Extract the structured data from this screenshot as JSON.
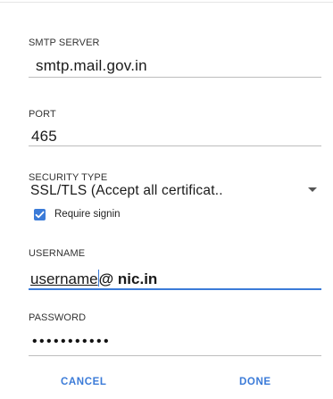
{
  "smtp_server": {
    "label": "SMTP SERVER",
    "value": "smtp.mail.gov.in"
  },
  "port": {
    "label": "PORT",
    "value": "465"
  },
  "security_type": {
    "label": "SECURITY TYPE",
    "value": "SSL/TLS (Accept all certificat..",
    "icon": "dropdown-arrow-icon"
  },
  "require_signin": {
    "label": "Require signin",
    "checked": true,
    "icon": "checkmark-icon"
  },
  "username": {
    "label": "USERNAME",
    "value_part1": "username",
    "value_part2": "@ nic.in"
  },
  "password": {
    "label": "PASSWORD",
    "value": "•••••••••••"
  },
  "buttons": {
    "cancel": "CANCEL",
    "done": "DONE"
  },
  "colors": {
    "accent": "#3b7bd8",
    "divider": "#bdbdbd",
    "text": "#1a1a1a"
  }
}
